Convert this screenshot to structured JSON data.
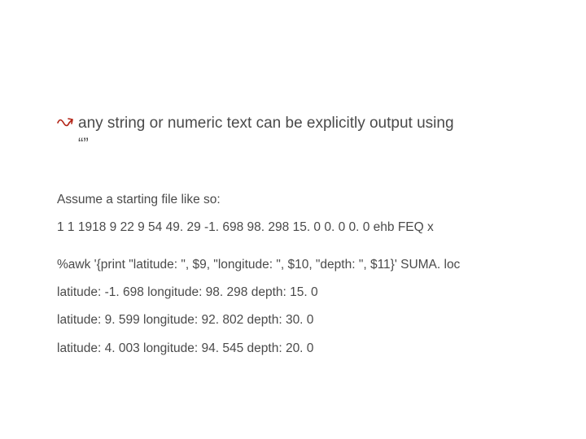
{
  "bullet": {
    "text": "any string or numeric text can be explicitly  output using",
    "sub": "“”"
  },
  "lines": {
    "assume": "Assume a starting file like so:",
    "sample": "1 1 1918 9 22 9 54 49. 29   -1. 698   98. 298   15. 0  0. 0  0. 0 ehb FEQ  x",
    "cmd": "%awk '{print \"latitude: \", $9, \"longitude: \", $10, \"depth: \", $11}'   SUMA. loc",
    "out1": "latitude: -1. 698 longitude: 98. 298 depth: 15. 0",
    "out2": "latitude: 9. 599 longitude: 92. 802 depth: 30. 0",
    "out3": "latitude: 4. 003 longitude: 94. 545 depth: 20. 0"
  }
}
